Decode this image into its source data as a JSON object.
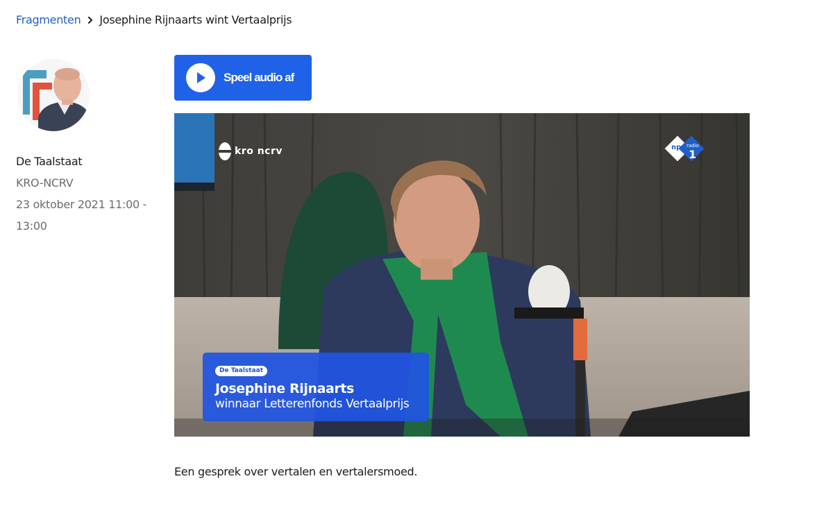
{
  "breadcrumb": {
    "parent": "Fragmenten",
    "separator_icon": "chevron-right-icon",
    "current": "Josephine Rijnaarts wint Vertaalprijs"
  },
  "program": {
    "name": "De Taalstaat",
    "broadcaster": "KRO-NCRV",
    "date": "23 oktober 2021 11:00 - 13:00"
  },
  "audio_button": {
    "label": "Speel audio af",
    "icon": "play-icon"
  },
  "video": {
    "logo_left": "kro ncrv",
    "logo_right_brand": "npo",
    "logo_right_channel": "radio",
    "logo_right_number": "1",
    "lower_third": {
      "badge": "De Taalstaat",
      "name": "Josephine Rijnaarts",
      "role": "winnaar Letterenfonds Vertaalprijs"
    }
  },
  "description": "Een gesprek over vertalen en vertalersmoed.",
  "colors": {
    "link": "#1f5fc8",
    "accent": "#1f62e8",
    "muted_text": "#6c6c6c",
    "lower_third_bg": "#2054e1"
  }
}
